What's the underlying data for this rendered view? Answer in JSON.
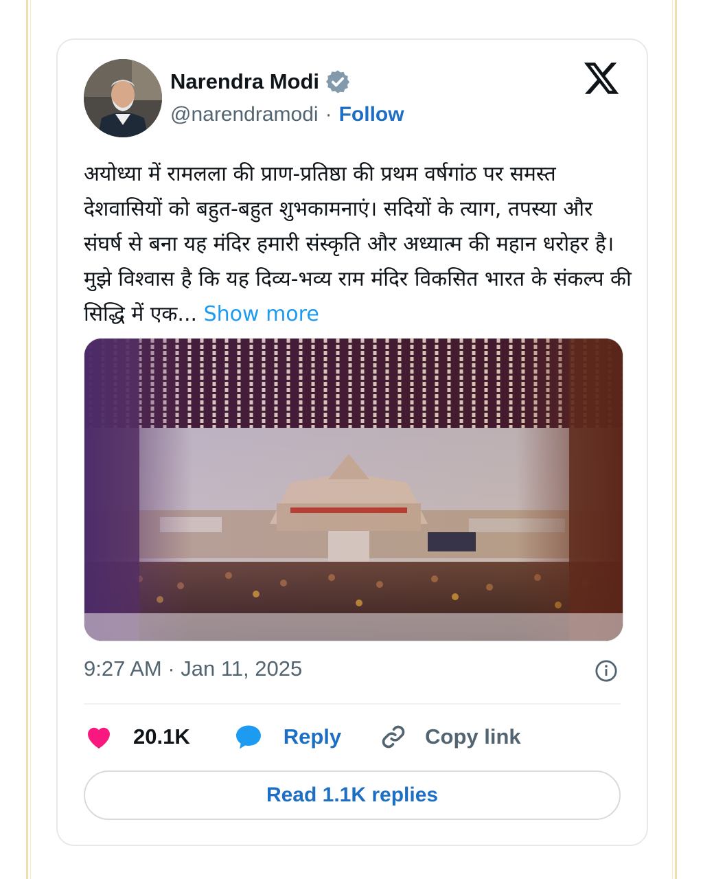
{
  "author": {
    "name": "Narendra Modi",
    "handle": "@narendramodi",
    "separator": "·",
    "follow_label": "Follow"
  },
  "tweet": {
    "text": "अयोध्या में रामलला की प्राण-प्रतिष्ठा की प्रथम वर्षगांठ पर समस्त देशवासियों को बहुत-बहुत शुभकामनाएं। सदियों के त्याग, तपस्या और संघर्ष से बना यह मंदिर हमारी संस्कृति और अध्यात्म की महान धरोहर है। मुझे विश्वास है कि यह दिव्य-भव्य राम मंदिर विकसित भारत के संकल्प की सिद्धि में एक...",
    "show_more_label": "Show more",
    "timestamp": "9:27 AM · Jan 11, 2025"
  },
  "actions": {
    "likes": "20.1K",
    "reply_label": "Reply",
    "copy_link_label": "Copy link"
  },
  "read_replies_label": "Read 1.1K replies",
  "icons": {
    "verified": "verified-badge-icon",
    "platform": "x-logo-icon",
    "info": "info-icon",
    "like": "heart-icon",
    "reply": "speech-bubble-icon",
    "copy": "link-icon"
  },
  "colors": {
    "accent": "#1d9bf0",
    "follow": "#1d6ec5",
    "heart": "#f91880",
    "text": "#0f1419",
    "secondary": "#536471"
  }
}
